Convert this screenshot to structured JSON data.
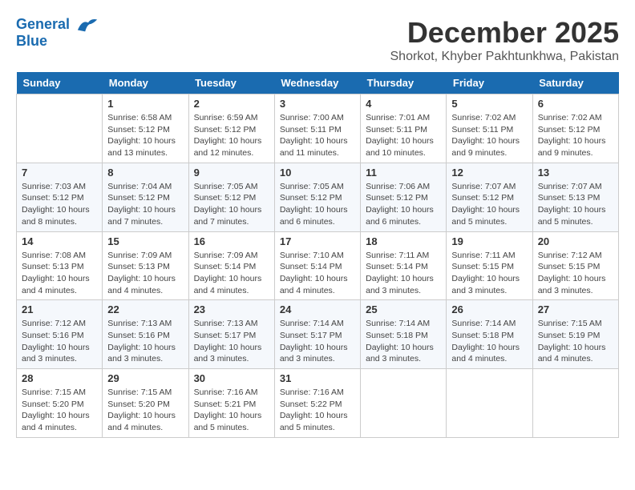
{
  "logo": {
    "line1": "General",
    "line2": "Blue"
  },
  "title": "December 2025",
  "location": "Shorkot, Khyber Pakhtunkhwa, Pakistan",
  "weekdays": [
    "Sunday",
    "Monday",
    "Tuesday",
    "Wednesday",
    "Thursday",
    "Friday",
    "Saturday"
  ],
  "weeks": [
    [
      {
        "day": "",
        "sunrise": "",
        "sunset": "",
        "daylight": ""
      },
      {
        "day": "1",
        "sunrise": "Sunrise: 6:58 AM",
        "sunset": "Sunset: 5:12 PM",
        "daylight": "Daylight: 10 hours and 13 minutes."
      },
      {
        "day": "2",
        "sunrise": "Sunrise: 6:59 AM",
        "sunset": "Sunset: 5:12 PM",
        "daylight": "Daylight: 10 hours and 12 minutes."
      },
      {
        "day": "3",
        "sunrise": "Sunrise: 7:00 AM",
        "sunset": "Sunset: 5:11 PM",
        "daylight": "Daylight: 10 hours and 11 minutes."
      },
      {
        "day": "4",
        "sunrise": "Sunrise: 7:01 AM",
        "sunset": "Sunset: 5:11 PM",
        "daylight": "Daylight: 10 hours and 10 minutes."
      },
      {
        "day": "5",
        "sunrise": "Sunrise: 7:02 AM",
        "sunset": "Sunset: 5:11 PM",
        "daylight": "Daylight: 10 hours and 9 minutes."
      },
      {
        "day": "6",
        "sunrise": "Sunrise: 7:02 AM",
        "sunset": "Sunset: 5:12 PM",
        "daylight": "Daylight: 10 hours and 9 minutes."
      }
    ],
    [
      {
        "day": "7",
        "sunrise": "Sunrise: 7:03 AM",
        "sunset": "Sunset: 5:12 PM",
        "daylight": "Daylight: 10 hours and 8 minutes."
      },
      {
        "day": "8",
        "sunrise": "Sunrise: 7:04 AM",
        "sunset": "Sunset: 5:12 PM",
        "daylight": "Daylight: 10 hours and 7 minutes."
      },
      {
        "day": "9",
        "sunrise": "Sunrise: 7:05 AM",
        "sunset": "Sunset: 5:12 PM",
        "daylight": "Daylight: 10 hours and 7 minutes."
      },
      {
        "day": "10",
        "sunrise": "Sunrise: 7:05 AM",
        "sunset": "Sunset: 5:12 PM",
        "daylight": "Daylight: 10 hours and 6 minutes."
      },
      {
        "day": "11",
        "sunrise": "Sunrise: 7:06 AM",
        "sunset": "Sunset: 5:12 PM",
        "daylight": "Daylight: 10 hours and 6 minutes."
      },
      {
        "day": "12",
        "sunrise": "Sunrise: 7:07 AM",
        "sunset": "Sunset: 5:12 PM",
        "daylight": "Daylight: 10 hours and 5 minutes."
      },
      {
        "day": "13",
        "sunrise": "Sunrise: 7:07 AM",
        "sunset": "Sunset: 5:13 PM",
        "daylight": "Daylight: 10 hours and 5 minutes."
      }
    ],
    [
      {
        "day": "14",
        "sunrise": "Sunrise: 7:08 AM",
        "sunset": "Sunset: 5:13 PM",
        "daylight": "Daylight: 10 hours and 4 minutes."
      },
      {
        "day": "15",
        "sunrise": "Sunrise: 7:09 AM",
        "sunset": "Sunset: 5:13 PM",
        "daylight": "Daylight: 10 hours and 4 minutes."
      },
      {
        "day": "16",
        "sunrise": "Sunrise: 7:09 AM",
        "sunset": "Sunset: 5:14 PM",
        "daylight": "Daylight: 10 hours and 4 minutes."
      },
      {
        "day": "17",
        "sunrise": "Sunrise: 7:10 AM",
        "sunset": "Sunset: 5:14 PM",
        "daylight": "Daylight: 10 hours and 4 minutes."
      },
      {
        "day": "18",
        "sunrise": "Sunrise: 7:11 AM",
        "sunset": "Sunset: 5:14 PM",
        "daylight": "Daylight: 10 hours and 3 minutes."
      },
      {
        "day": "19",
        "sunrise": "Sunrise: 7:11 AM",
        "sunset": "Sunset: 5:15 PM",
        "daylight": "Daylight: 10 hours and 3 minutes."
      },
      {
        "day": "20",
        "sunrise": "Sunrise: 7:12 AM",
        "sunset": "Sunset: 5:15 PM",
        "daylight": "Daylight: 10 hours and 3 minutes."
      }
    ],
    [
      {
        "day": "21",
        "sunrise": "Sunrise: 7:12 AM",
        "sunset": "Sunset: 5:16 PM",
        "daylight": "Daylight: 10 hours and 3 minutes."
      },
      {
        "day": "22",
        "sunrise": "Sunrise: 7:13 AM",
        "sunset": "Sunset: 5:16 PM",
        "daylight": "Daylight: 10 hours and 3 minutes."
      },
      {
        "day": "23",
        "sunrise": "Sunrise: 7:13 AM",
        "sunset": "Sunset: 5:17 PM",
        "daylight": "Daylight: 10 hours and 3 minutes."
      },
      {
        "day": "24",
        "sunrise": "Sunrise: 7:14 AM",
        "sunset": "Sunset: 5:17 PM",
        "daylight": "Daylight: 10 hours and 3 minutes."
      },
      {
        "day": "25",
        "sunrise": "Sunrise: 7:14 AM",
        "sunset": "Sunset: 5:18 PM",
        "daylight": "Daylight: 10 hours and 3 minutes."
      },
      {
        "day": "26",
        "sunrise": "Sunrise: 7:14 AM",
        "sunset": "Sunset: 5:18 PM",
        "daylight": "Daylight: 10 hours and 4 minutes."
      },
      {
        "day": "27",
        "sunrise": "Sunrise: 7:15 AM",
        "sunset": "Sunset: 5:19 PM",
        "daylight": "Daylight: 10 hours and 4 minutes."
      }
    ],
    [
      {
        "day": "28",
        "sunrise": "Sunrise: 7:15 AM",
        "sunset": "Sunset: 5:20 PM",
        "daylight": "Daylight: 10 hours and 4 minutes."
      },
      {
        "day": "29",
        "sunrise": "Sunrise: 7:15 AM",
        "sunset": "Sunset: 5:20 PM",
        "daylight": "Daylight: 10 hours and 4 minutes."
      },
      {
        "day": "30",
        "sunrise": "Sunrise: 7:16 AM",
        "sunset": "Sunset: 5:21 PM",
        "daylight": "Daylight: 10 hours and 5 minutes."
      },
      {
        "day": "31",
        "sunrise": "Sunrise: 7:16 AM",
        "sunset": "Sunset: 5:22 PM",
        "daylight": "Daylight: 10 hours and 5 minutes."
      },
      {
        "day": "",
        "sunrise": "",
        "sunset": "",
        "daylight": ""
      },
      {
        "day": "",
        "sunrise": "",
        "sunset": "",
        "daylight": ""
      },
      {
        "day": "",
        "sunrise": "",
        "sunset": "",
        "daylight": ""
      }
    ]
  ]
}
